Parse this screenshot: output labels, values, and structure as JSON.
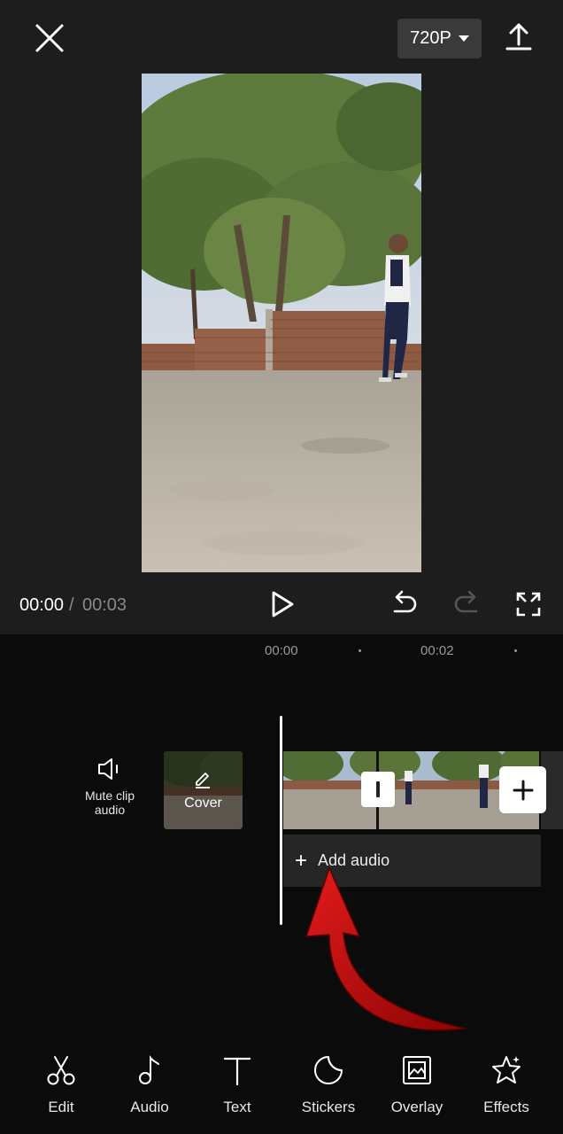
{
  "header": {
    "resolution": "720P",
    "close_icon": "close-icon",
    "export_icon": "export-upload-icon"
  },
  "player": {
    "current_time": "00:00",
    "separator": "/",
    "total_time": "00:03"
  },
  "timeline": {
    "ruler_labels": [
      "00:00",
      "00:02"
    ],
    "mute_label": "Mute clip audio",
    "cover_label": "Cover",
    "add_audio_label": "Add audio"
  },
  "toolbar": {
    "items": [
      {
        "label": "Edit",
        "icon": "scissors-icon"
      },
      {
        "label": "Audio",
        "icon": "music-note-icon"
      },
      {
        "label": "Text",
        "icon": "text-icon"
      },
      {
        "label": "Stickers",
        "icon": "sticker-icon"
      },
      {
        "label": "Overlay",
        "icon": "overlay-icon"
      },
      {
        "label": "Effects",
        "icon": "star-effects-icon"
      }
    ]
  },
  "colors": {
    "preview_bg": "#1d1d1d",
    "timeline_bg": "#0b0b0b",
    "arrow": "#c40e0e"
  }
}
